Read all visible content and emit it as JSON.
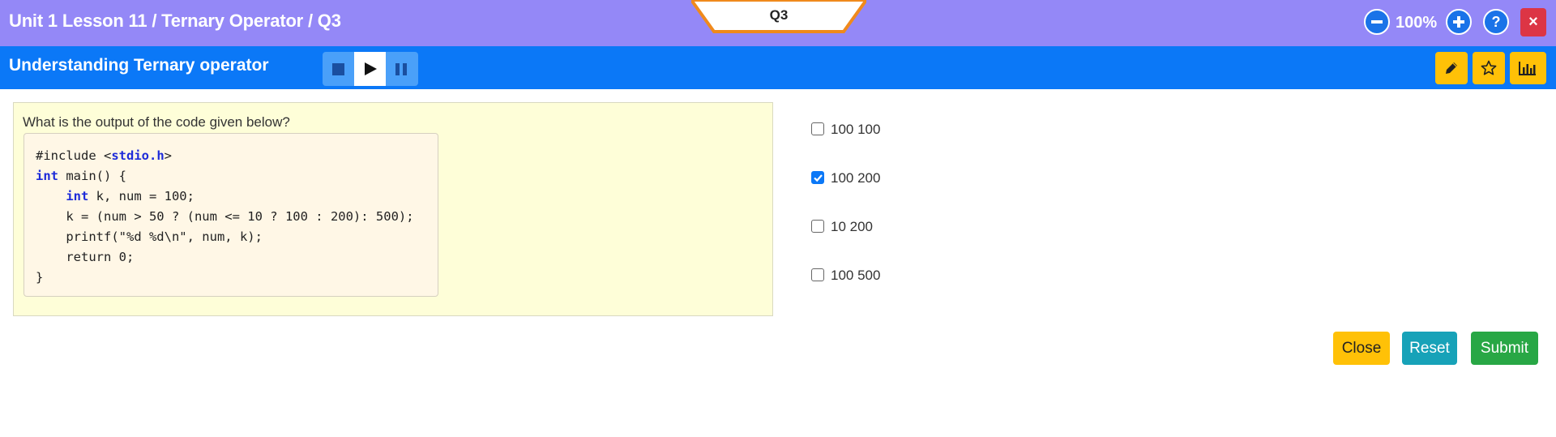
{
  "header": {
    "title": "Unit 1 Lesson 11 / Ternary Operator / Q3",
    "question_tab": "Q3",
    "zoom_level": "100%",
    "zoom_out_icon": "minus-circle-icon",
    "zoom_in_icon": "plus-circle-icon",
    "help_label": "?",
    "close_label": "×",
    "colors": {
      "bar": "#9488f7",
      "tab_border": "#f08a1c",
      "close": "#dc3545"
    }
  },
  "subheader": {
    "title": "Understanding Ternary operator",
    "media_controls": [
      "stop-icon",
      "play-icon",
      "pause-icon"
    ],
    "tools": [
      "pencil-icon",
      "star-icon",
      "bar-chart-icon"
    ],
    "colors": {
      "bar": "#0b78f7",
      "tool": "#ffc107"
    }
  },
  "question": {
    "text": "What is the output of the code given below?",
    "code_lines": [
      "#include <stdio.h>",
      "int main() {",
      "    int k, num = 100;",
      "    k = (num > 50 ? (num <= 10 ? 100 : 200): 500);",
      "    printf(\"%d %d\\n\", num, k);",
      "    return 0;",
      "}"
    ]
  },
  "options": [
    {
      "label": "100 100",
      "checked": false
    },
    {
      "label": "100 200",
      "checked": true
    },
    {
      "label": "10 200",
      "checked": false
    },
    {
      "label": "100 500",
      "checked": false
    }
  ],
  "actions": {
    "close": "Close",
    "reset": "Reset",
    "submit": "Submit",
    "colors": {
      "close": "#ffc107",
      "reset": "#17a2b8",
      "submit": "#28a745"
    }
  }
}
